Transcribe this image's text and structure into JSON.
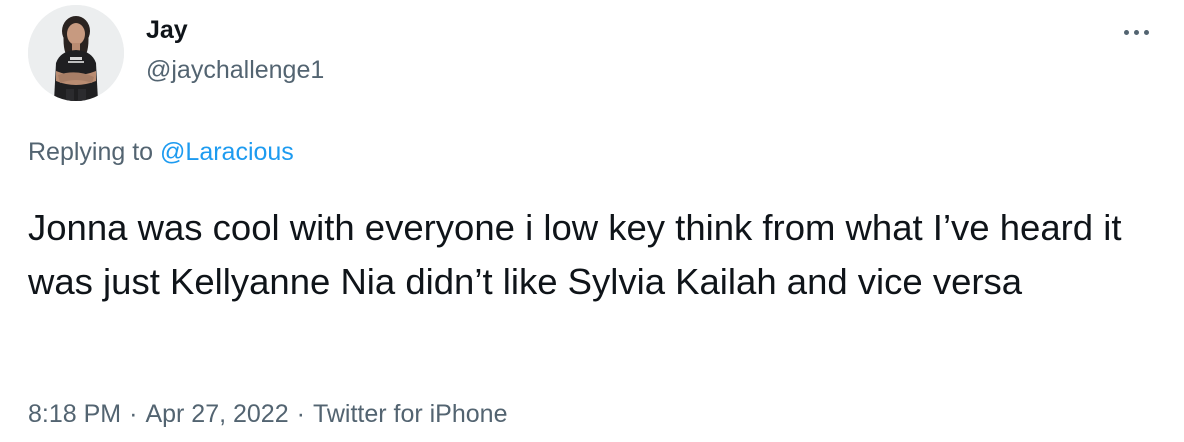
{
  "author": {
    "display_name": "Jay",
    "handle": "@jaychallenge1"
  },
  "reply": {
    "prefix": "Replying to",
    "mention": "@Laracious"
  },
  "tweet": {
    "text": "Jonna was cool with everyone i low key think from what I’ve heard it was just Kellyanne Nia didn’t like Sylvia Kailah and vice versa"
  },
  "meta": {
    "time": "8:18 PM",
    "date": "Apr 27, 2022",
    "source": "Twitter for iPhone",
    "separator": "·"
  },
  "icons": {
    "more": "more-horizontal-icon",
    "avatar": "profile-photo"
  },
  "colors": {
    "text_primary": "#0f1419",
    "text_secondary": "#536471",
    "link": "#1d9bf0",
    "background": "#ffffff"
  }
}
